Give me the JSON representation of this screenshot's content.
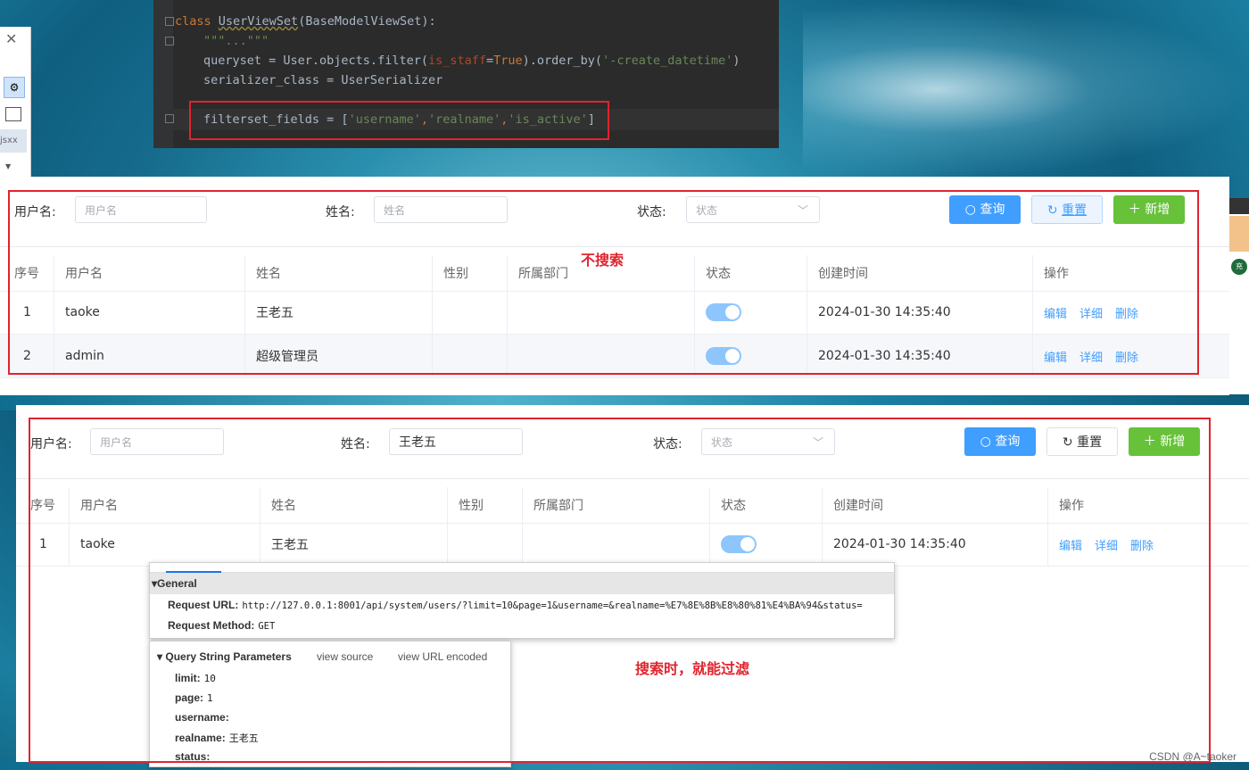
{
  "code_editor": {
    "lines": {
      "l1_kw": "class",
      "l1_name": "UserViewSet",
      "l1_rest": "(BaseModelViewSet):",
      "l2": "\"\"\"...\"\"\"",
      "l3_a": "queryset = User.objects.filter(",
      "l3_param": "is_staff",
      "l3_b": "=",
      "l3_true": "True",
      "l3_c": ").order_by(",
      "l3_str": "'-create_datetime'",
      "l3_d": ")",
      "l4": "serializer_class = UserSerializer",
      "l5_a": "filterset_fields = [",
      "l5_s1": "'username'",
      "l5_c1": ",",
      "l5_s2": "'realname'",
      "l5_c2": ",",
      "l5_s3": "'is_active'",
      "l5_end": "]"
    }
  },
  "ide_left": {
    "tag": "jsxx"
  },
  "panel1": {
    "search": {
      "username_label": "用户名:",
      "username_placeholder": "用户名",
      "realname_label": "姓名:",
      "realname_placeholder": "姓名",
      "status_label": "状态:",
      "status_placeholder": "状态",
      "search_btn": "查询",
      "reset_btn": "重置",
      "add_btn": "新增"
    },
    "annotation": "不搜索",
    "headers": [
      "序号",
      "用户名",
      "姓名",
      "性别",
      "所属部门",
      "状态",
      "创建时间",
      "操作"
    ],
    "rows": [
      {
        "idx": "1",
        "username": "taoke",
        "realname": "王老五",
        "gender": "",
        "dept": "",
        "active": true,
        "created": "2024-01-30 14:35:40"
      },
      {
        "idx": "2",
        "username": "admin",
        "realname": "超级管理员",
        "gender": "",
        "dept": "",
        "active": true,
        "created": "2024-01-30 14:35:40"
      }
    ],
    "actions": {
      "edit": "编辑",
      "detail": "详细",
      "delete": "删除"
    }
  },
  "panel2": {
    "search": {
      "username_label": "用户名:",
      "username_placeholder": "用户名",
      "realname_label": "姓名:",
      "realname_value": "王老五",
      "status_label": "状态:",
      "status_placeholder": "状态",
      "search_btn": "查询",
      "reset_btn": "重置",
      "add_btn": "新增"
    },
    "headers": [
      "序号",
      "用户名",
      "姓名",
      "性别",
      "所属部门",
      "状态",
      "创建时间",
      "操作"
    ],
    "rows": [
      {
        "idx": "1",
        "username": "taoke",
        "realname": "王老五",
        "gender": "",
        "dept": "",
        "active": true,
        "created": "2024-01-30 14:35:40"
      }
    ],
    "actions": {
      "edit": "编辑",
      "detail": "详细",
      "delete": "删除"
    },
    "annotation": "搜索时，就能过滤"
  },
  "devtools": {
    "general_title": "General",
    "request_url_label": "Request URL:",
    "request_url_value": "http://127.0.0.1:8001/api/system/users/?limit=10&page=1&username=&realname=%E7%8E%8B%E8%80%81%E4%BA%94&status=",
    "request_method_label": "Request Method:",
    "request_method_value": "GET"
  },
  "query_string": {
    "title": "Query String Parameters",
    "view_source": "view source",
    "view_url_encoded": "view URL encoded",
    "params": [
      {
        "key": "limit:",
        "value": "10"
      },
      {
        "key": "page:",
        "value": "1"
      },
      {
        "key": "username:",
        "value": ""
      },
      {
        "key": "realname:",
        "value": "王老五"
      },
      {
        "key": "status:",
        "value": ""
      }
    ]
  },
  "right_fragment": {
    "badge": "充"
  },
  "watermark": "CSDN @A~taoker",
  "colors": {
    "primary": "#409eff",
    "success": "#67c23a",
    "annotation_red": "#e0242e",
    "switch_on": "#8ec5fc"
  }
}
